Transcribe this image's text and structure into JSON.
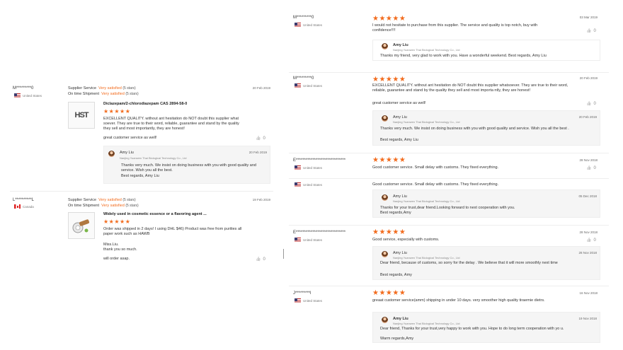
{
  "left": {
    "reviews": [
      {
        "name": "M*********0",
        "country": "United States",
        "flag": "us",
        "service_label": "Supplier Service",
        "service_value": "Very satisfied",
        "service_stars": "(5 stars)",
        "shipment_label": "On time Shipment",
        "shipment_value": "Very satisfied",
        "shipment_stars": "(5 stars)",
        "date": "20 Feb 2019",
        "product": "Diclazepam/2-chlorodiazepam CAS 2894-58-0",
        "product_image_text": "HST",
        "text": "EXCELLENT QUALITY. without ant hesitation do NOT doubt this supplier what soever. They are true to their word, reliable, guarantee and stand by the quality they sell and most importantly, they are honest!",
        "text2": "great customer service as well!",
        "likes": "0",
        "reply": {
          "name": "Amy Liu",
          "company": "Nanjing Yuanwen Thai Biological Technology Co., Ltd",
          "date": "20 Feb 2019",
          "text": "Thanks very much. We insist on doing business with you with good quality and service. Wish you all the best.",
          "text2": "Best regards, Amy Liu"
        }
      },
      {
        "name": "L**********L",
        "country": "Canada",
        "flag": "ca",
        "service_label": "Supplier Service",
        "service_value": "Very satisfied",
        "service_stars": "(5 stars)",
        "shipment_label": "On time Shipment",
        "shipment_value": "Very satisfied",
        "shipment_stars": "(5 stars)",
        "date": "19 Feb 2019",
        "product": "Widely used in cosmetic essence or a flavoring agent ...",
        "text": "Order was shipped in 2 days! I using DHL $46) Product was free from purities all paper work such as HAWB",
        "text2": "Miss.Liu.",
        "text3": "thank you so much.",
        "text4": "will order asap.",
        "likes": "0"
      }
    ]
  },
  "right": {
    "reviews": [
      {
        "name": "M*********0",
        "country": "United States",
        "date": "03 Mar 2019",
        "text": "I would not hesitate to purchase from this supplier. The service and quality is top notch, buy with confidence!!!!",
        "likes": "0",
        "reply": {
          "name": "Amy Liu",
          "company": "Nanjing Yuanwen Thai Biological Technology Co., Ltd",
          "text": "Thanks my friend, very glad to work with you. Have a wonderful weekend.  Best regards, Amy Liu"
        }
      },
      {
        "name": "M*********0",
        "country": "United States",
        "date": "20 Feb 2019",
        "text": "EXCELLENT QUALITY. without ant hesitation do NOT doubt this supplier whatsoever. They are true to their word, reliable, guarantee and stand by the quality they sell and most importa ntly, they are honest!",
        "text2": "great customer service as well!",
        "likes": "0",
        "reply": {
          "name": "Amy Liu",
          "company": "Nanjing Yuanwen Thai Biological Technology Co., Ltd",
          "date": "20 Feb 2019",
          "text": "Thanks very much. We insist on doing business with you with good quality and service. Wish you all the best .",
          "text2": "Best regards, Amy Liu"
        }
      },
      {
        "name": "E******************************",
        "country": "United States",
        "date": "28 Nov 2018",
        "text": "Good customer service. Small delay with customs. They fixed everything.",
        "likes": "0"
      },
      {
        "country": "United States",
        "text": "Good customer service. Small delay with customs. They fixed everything.",
        "reply": {
          "name": "Amy Liu",
          "company": "Nanjing Yuanwen Thai Biological Technology Co., Ltd",
          "date": "05 Dec 2018",
          "text": "Thanks for your trust,dear friend.Looking forward to next cooperation with you.",
          "text2": "Best regards,Amy"
        }
      },
      {
        "name": "E******************************",
        "country": "United States",
        "date": "28 Nov 2018",
        "text": "Good service, especially with customs.",
        "likes": "0",
        "reply": {
          "name": "Amy Liu",
          "company": "Nanjing Yuanwen Thai Biological Technology Co., Ltd",
          "date": "28 Nov 2018",
          "text": "Dear friend, because of customs, so sorry for the delay . We believe that it will more smoothly next time",
          "text2": "Best regards, Amy"
        }
      },
      {
        "name": "J*********l",
        "country": "United States",
        "date": "16 Nov 2018",
        "text": "greaat customer service(amm) shipping in under 10 days. very smoother high quality tiraemie dietrs.",
        "reply": {
          "name": "Amy Liu",
          "company": "Nanjing Yuanwen Thai Biological Technology Co., Ltd",
          "date": "19 Nov 2018",
          "text": "Dear friend, Thanks for your trust,very happy to work with you. Hope to do long term cooperation with yo u.",
          "text2": "Warm regards,Amy"
        }
      }
    ]
  },
  "stars": "★★★★★",
  "like_icon": "👍"
}
